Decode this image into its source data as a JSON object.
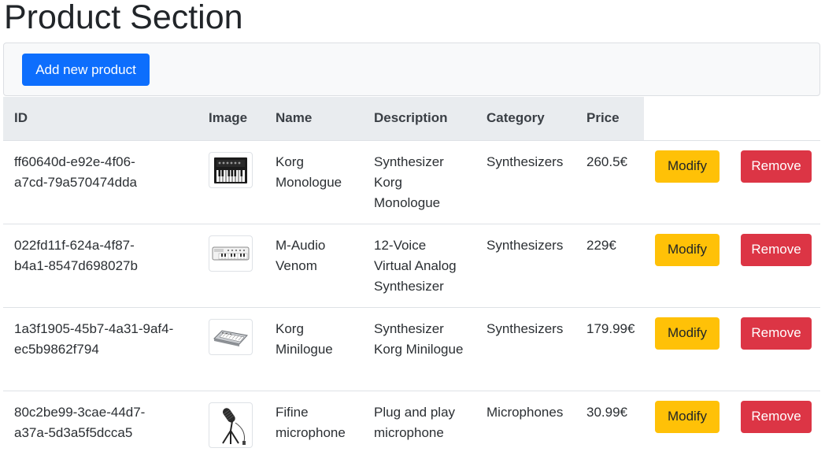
{
  "page": {
    "title": "Product Section"
  },
  "toolbar": {
    "add_label": "Add new product"
  },
  "table": {
    "headers": {
      "id": "ID",
      "image": "Image",
      "name": "Name",
      "description": "Description",
      "category": "Category",
      "price": "Price"
    },
    "rows": [
      {
        "id_line1": "ff60640d-e92e-4f06-",
        "id_line2": "a7cd-79a570474dda",
        "image_icon": "synthesizer-image-icon",
        "name": "Korg Monologue",
        "description": "Synthesizer Korg Monologue",
        "category": "Synthesizers",
        "price": "260.5€",
        "modify_label": "Modify",
        "remove_label": "Remove"
      },
      {
        "id_line1": "022fd11f-624a-4f87-",
        "id_line2": "b4a1-8547d698027b",
        "image_icon": "synthesizer-image-icon",
        "name": "M-Audio Venom",
        "description": "12-Voice Virtual Analog Synthesizer",
        "category": "Synthesizers",
        "price": "229€",
        "modify_label": "Modify",
        "remove_label": "Remove"
      },
      {
        "id_line1": "1a3f1905-45b7-4a31-9af4-",
        "id_line2": "ec5b9862f794",
        "image_icon": "synthesizer-image-icon",
        "name": "Korg Minilogue",
        "description": "Synthesizer Korg Minilogue",
        "category": "Synthesizers",
        "price": "179.99€",
        "modify_label": "Modify",
        "remove_label": "Remove"
      },
      {
        "id_line1": "80c2be99-3cae-44d7-",
        "id_line2": "a37a-5d3a5f5dcca5",
        "image_icon": "microphone-image-icon",
        "name": "Fifine microphone",
        "description": "Plug and play microphone",
        "category": "Microphones",
        "price": "30.99€",
        "modify_label": "Modify",
        "remove_label": "Remove"
      }
    ]
  },
  "colors": {
    "primary": "#0d6efd",
    "warning": "#ffc107",
    "danger": "#dc3545",
    "header_bg": "#e9ecef",
    "toolbar_bg": "#f8f9fa"
  }
}
